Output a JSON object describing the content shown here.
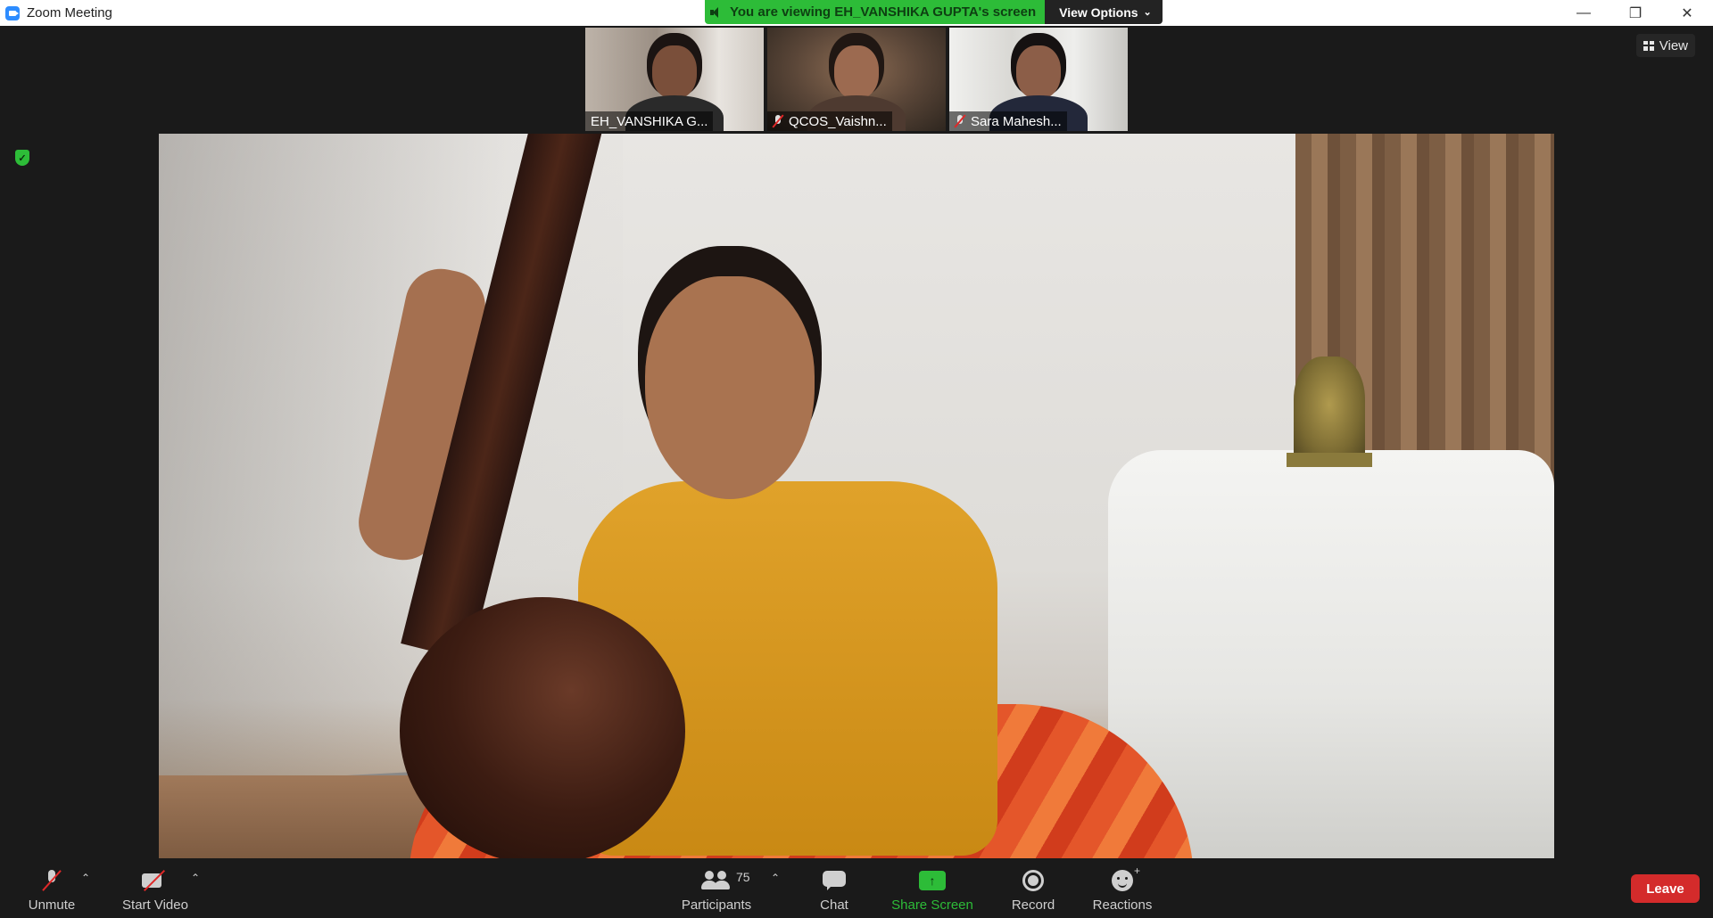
{
  "window": {
    "title": "Zoom Meeting",
    "minimize": "—",
    "restore": "❐",
    "close": "✕"
  },
  "banner": {
    "viewing_text": "You are viewing EH_VANSHIKA GUPTA's screen",
    "view_options_label": "View Options",
    "view_options_chevron": "⌄"
  },
  "view_button": {
    "label": "View"
  },
  "participants_strip": [
    {
      "name": "EH_VANSHIKA G...",
      "muted": false,
      "active": false
    },
    {
      "name": "QCOS_Vaishn...",
      "muted": true,
      "active": false
    },
    {
      "name": "Sara Mahesh...",
      "muted": true,
      "active": true
    }
  ],
  "security": {
    "icon": "shield-check-icon",
    "glyph": "✓",
    "color": "#2dbc38"
  },
  "toolbar": {
    "unmute_label": "Unmute",
    "start_video_label": "Start Video",
    "participants_label": "Participants",
    "participants_count": "75",
    "chat_label": "Chat",
    "share_label": "Share Screen",
    "record_label": "Record",
    "reactions_label": "Reactions",
    "leave_label": "Leave",
    "caret": "⌃",
    "share_arrow": "↑",
    "reaction_plus": "+"
  },
  "colors": {
    "accent_green": "#2dbc38",
    "leave_red": "#d42b2b",
    "active_border": "#a7e24d",
    "background": "#1a1a1a"
  }
}
